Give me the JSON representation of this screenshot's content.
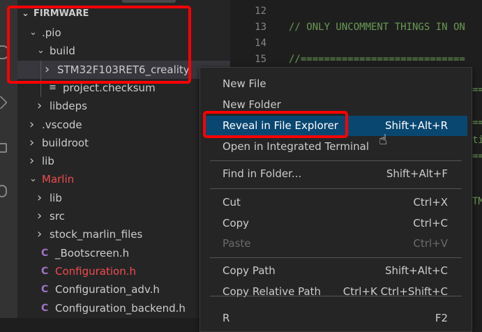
{
  "explorer": {
    "root": "FIRMWARE",
    "items": [
      {
        "label": ".pio",
        "type": "folder",
        "expanded": true
      },
      {
        "label": "build",
        "type": "folder",
        "expanded": true
      },
      {
        "label": "STM32F103RET6_creality",
        "type": "folder",
        "expanded": false,
        "selected": true
      },
      {
        "label": "project.checksum",
        "type": "file"
      },
      {
        "label": "libdeps",
        "type": "folder"
      },
      {
        "label": ".vscode",
        "type": "folder"
      },
      {
        "label": "buildroot",
        "type": "folder"
      },
      {
        "label": "lib",
        "type": "folder"
      },
      {
        "label": "Marlin",
        "type": "folder",
        "expanded": true,
        "modified": true
      },
      {
        "label": "lib",
        "type": "folder"
      },
      {
        "label": "src",
        "type": "folder"
      },
      {
        "label": "stock_marlin_files",
        "type": "folder"
      },
      {
        "label": "_Bootscreen.h",
        "type": "c-file"
      },
      {
        "label": "Configuration.h",
        "type": "c-file",
        "modified": true
      },
      {
        "label": "Configuration_adv.h",
        "type": "c-file"
      },
      {
        "label": "Configuration_backend.h",
        "type": "c-file"
      }
    ],
    "c_icon": "C"
  },
  "editor": {
    "lines": [
      {
        "n": "12",
        "text": ""
      },
      {
        "n": "13",
        "text": "// ONLY UNCOMMENT THINGS IN ON"
      },
      {
        "n": "14",
        "text": ""
      },
      {
        "n": "15",
        "text": "//============================"
      }
    ]
  },
  "context_menu": {
    "items": [
      {
        "label": "New File",
        "key": ""
      },
      {
        "label": "New Folder",
        "key": ""
      },
      {
        "label": "Reveal in File Explorer",
        "key": "Shift+Alt+R",
        "highlighted": true
      },
      {
        "label": "Open in Integrated Terminal",
        "key": ""
      },
      {
        "label": "Find in Folder...",
        "key": "Shift+Alt+F"
      },
      {
        "label": "Cut",
        "key": "Ctrl+X"
      },
      {
        "label": "Copy",
        "key": "Ctrl+C"
      },
      {
        "label": "Paste",
        "key": "Ctrl+V",
        "disabled": true
      },
      {
        "label": "Copy Path",
        "key": "Shift+Alt+C"
      },
      {
        "label": "Copy Relative Path",
        "key": "Ctrl+K Ctrl+Shift+C"
      },
      {
        "label": "R",
        "key": "F2"
      }
    ]
  },
  "colors": {
    "highlight": "#094771",
    "annotation": "#ff0000",
    "modified": "#f14c4c",
    "comment": "#6a9955"
  }
}
